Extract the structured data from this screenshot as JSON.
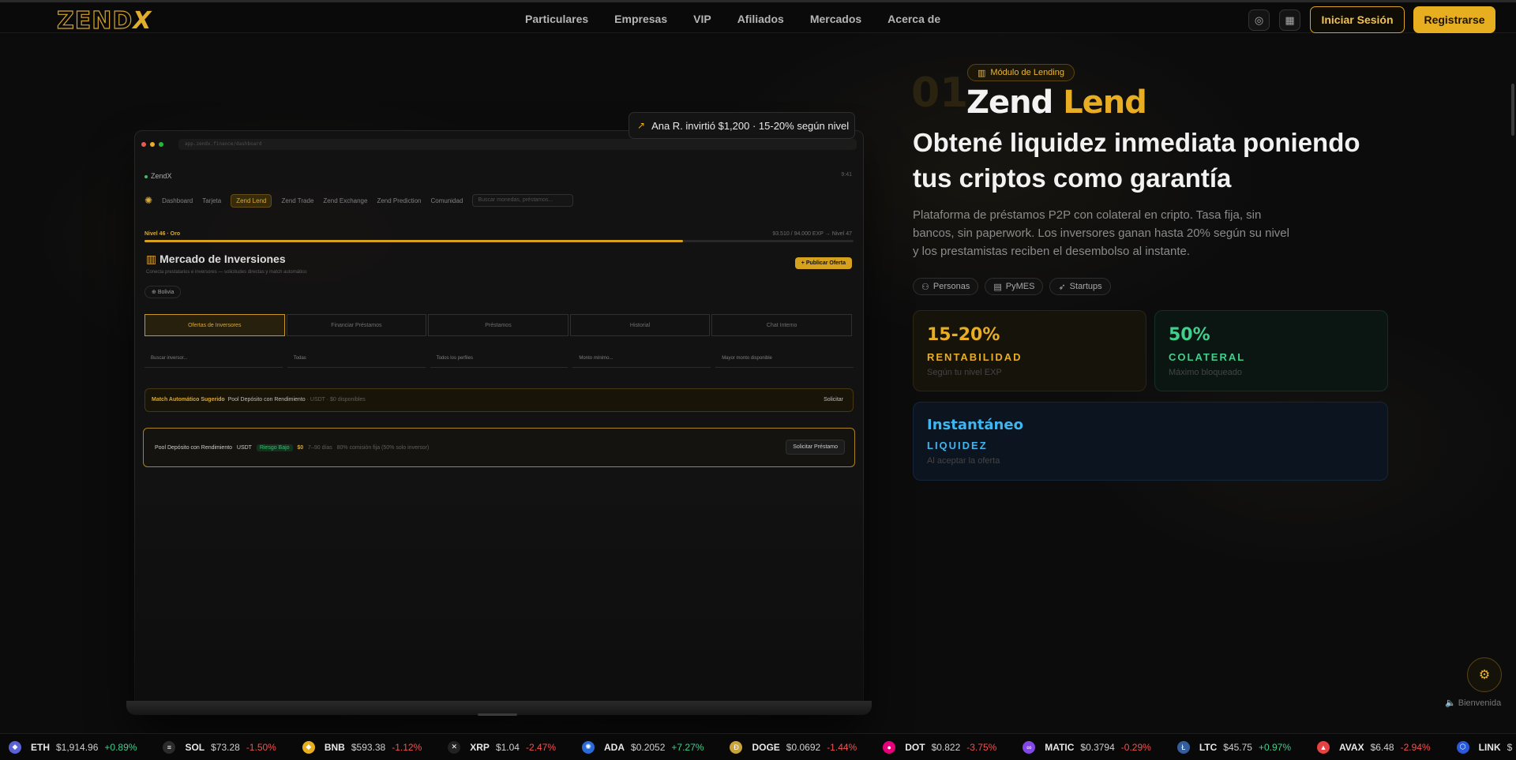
{
  "logo": {
    "main": "ZEND",
    "accent": "X"
  },
  "nav": [
    "Particulares",
    "Empresas",
    "VIP",
    "Afiliados",
    "Mercados",
    "Acerca de"
  ],
  "header": {
    "login": "Iniciar Sesión",
    "register": "Registrarse",
    "globe_icon": "globe-icon",
    "qr_icon": "qr-icon"
  },
  "toast": {
    "text": "Ana R. invirtió $1,200 · 15-20% según nivel"
  },
  "mock": {
    "url": "app.zendx.finance/dashboard",
    "brand": "ZendX",
    "time": "9:41",
    "nav": [
      "Dashboard",
      "Tarjeta",
      "Zend Lend",
      "Zend Trade",
      "Zend Exchange",
      "Zend Prediction",
      "Comunidad"
    ],
    "search_placeholder": "Buscar monedas, préstamos...",
    "level": "Nivel 46 · Oro",
    "level_progress_text": "93.510 / 94.000 EXP → Nivel 47",
    "level_progress": 0.76,
    "title": "Mercado de Inversiones",
    "subtitle": "Conecta prestatarios e inversores — solicitudes directas y match automático",
    "publish": "Publicar Oferta",
    "country": "Bolivia",
    "tabs": [
      "Ofertas de Inversores",
      "Financiar Préstamos",
      "Préstamos",
      "Historial",
      "Chat Interno"
    ],
    "filters": [
      "Buscar inversor...",
      "Todas",
      "Todos los perfiles",
      "Monto mínimo...",
      "Mayor monto disponible"
    ],
    "match": {
      "label": "Match Automático Sugerido",
      "pool": "Pool Depósito con Rendimiento",
      "meta": "· USDT · $0 disponibles",
      "action": "Solicitar"
    },
    "pool": {
      "name": "Pool Depósito con Rendimiento",
      "coin": "USDT",
      "risk": "Riesgo Bajo",
      "amount": "$0",
      "term": "7–90 días",
      "commission": "80% comisión fija (50% solo inversor)",
      "action": "Solicitar Préstamo"
    }
  },
  "hero": {
    "badge": "Módulo de Lending",
    "index": "01",
    "brand_white": "Zend",
    "brand_gold": "Lend",
    "headline": "Obtené liquidez inmediata poniendo tus criptos como garantía",
    "description": "Plataforma de préstamos P2P con colateral en cripto. Tasa fija, sin bancos, sin paperwork. Los inversores ganan hasta 20% según su nivel y los prestamistas reciben el desembolso al instante.",
    "chips": [
      "Personas",
      "PyMES",
      "Startups"
    ],
    "cards": [
      {
        "value": "15-20%",
        "label": "RENTABILIDAD",
        "sub": "Según tu nivel EXP"
      },
      {
        "value": "50%",
        "label": "COLATERAL",
        "sub": "Máximo bloqueado"
      },
      {
        "value": "Instantáneo",
        "label": "LIQUIDEZ",
        "sub": "Al aceptar la oferta"
      }
    ]
  },
  "assistant": {
    "label": "Bienvenida"
  },
  "ticker": [
    {
      "sym": "ETH",
      "price": "$1,914.96",
      "change": "+0.89%",
      "dir": "up",
      "color": "#5a62d6",
      "glyph": "◆"
    },
    {
      "sym": "SOL",
      "price": "$73.28",
      "change": "-1.50%",
      "dir": "down",
      "color": "#2b2b2b",
      "glyph": "≡"
    },
    {
      "sym": "BNB",
      "price": "$593.38",
      "change": "-1.12%",
      "dir": "down",
      "color": "#e7ae1f",
      "glyph": "◆"
    },
    {
      "sym": "XRP",
      "price": "$1.04",
      "change": "-2.47%",
      "dir": "down",
      "color": "#222",
      "glyph": "✕"
    },
    {
      "sym": "ADA",
      "price": "$0.2052",
      "change": "+7.27%",
      "dir": "up",
      "color": "#2a6bd8",
      "glyph": "✺"
    },
    {
      "sym": "DOGE",
      "price": "$0.0692",
      "change": "-1.44%",
      "dir": "down",
      "color": "#c9a33a",
      "glyph": "Ð"
    },
    {
      "sym": "DOT",
      "price": "$0.822",
      "change": "-3.75%",
      "dir": "down",
      "color": "#e6007a",
      "glyph": "●"
    },
    {
      "sym": "MATIC",
      "price": "$0.3794",
      "change": "-0.29%",
      "dir": "down",
      "color": "#8247e5",
      "glyph": "∞"
    },
    {
      "sym": "LTC",
      "price": "$45.75",
      "change": "+0.97%",
      "dir": "up",
      "color": "#345d9d",
      "glyph": "Ł"
    },
    {
      "sym": "AVAX",
      "price": "$6.48",
      "change": "-2.94%",
      "dir": "down",
      "color": "#e84142",
      "glyph": "▲"
    },
    {
      "sym": "LINK",
      "price": "$",
      "change": "",
      "dir": "up",
      "color": "#2a5ada",
      "glyph": "⬡"
    }
  ]
}
